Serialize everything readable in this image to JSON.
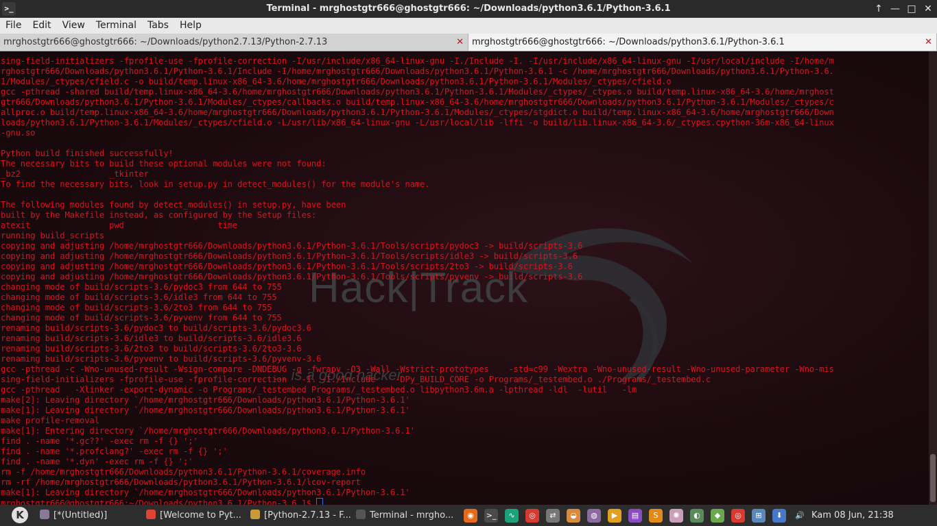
{
  "window": {
    "title": "Terminal - mrghostgtr666@ghostgtr666: ~/Downloads/python3.6.1/Python-3.6.1",
    "app_icon": ">_"
  },
  "menu": [
    "File",
    "Edit",
    "View",
    "Terminal",
    "Tabs",
    "Help"
  ],
  "tabs": [
    {
      "label": "mrghostgtr666@ghostgtr666: ~/Downloads/python2.7.13/Python-2.7.13",
      "close": "✕"
    },
    {
      "label": "mrghostgtr666@ghostgtr666: ~/Downloads/python3.6.1/Python-3.6.1",
      "close": "✕"
    }
  ],
  "terminal": {
    "lines": [
      "sing-field-initializers -fprofile-use -fprofile-correction -I/usr/include/x86_64-linux-gnu -I./Include -I. -I/usr/include/x86_64-linux-gnu -I/usr/local/include -I/home/m",
      "rghostgtr666/Downloads/python3.6.1/Python-3.6.1/Include -I/home/mrghostgtr666/Downloads/python3.6.1/Python-3.6.1 -c /home/mrghostgtr666/Downloads/python3.6.1/Python-3.6.",
      "1/Modules/_ctypes/cfield.c -o build/temp.linux-x86_64-3.6/home/mrghostgtr666/Downloads/python3.6.1/Python-3.6.1/Modules/_ctypes/cfield.o",
      "gcc -pthread -shared build/temp.linux-x86_64-3.6/home/mrghostgtr666/Downloads/python3.6.1/Python-3.6.1/Modules/_ctypes/_ctypes.o build/temp.linux-x86_64-3.6/home/mrghost",
      "gtr666/Downloads/python3.6.1/Python-3.6.1/Modules/_ctypes/callbacks.o build/temp.linux-x86_64-3.6/home/mrghostgtr666/Downloads/python3.6.1/Python-3.6.1/Modules/_ctypes/c",
      "allproc.o build/temp.linux-x86_64-3.6/home/mrghostgtr666/Downloads/python3.6.1/Python-3.6.1/Modules/_ctypes/stgdict.o build/temp.linux-x86_64-3.6/home/mrghostgtr666/Down",
      "loads/python3.6.1/Python-3.6.1/Modules/_ctypes/cfield.o -L/usr/lib/x86_64-linux-gnu -L/usr/local/lib -lffi -o build/lib.linux-x86_64-3.6/_ctypes.cpython-36m-x86_64-linux",
      "-gnu.so",
      "",
      "Python build finished successfully!",
      "The necessary bits to build these optional modules were not found:",
      "_bz2                  _tkinter",
      "To find the necessary bits, look in setup.py in detect_modules() for the module's name.",
      "",
      "The following modules found by detect_modules() in setup.py, have been",
      "built by the Makefile instead, as configured by the Setup files:",
      "atexit                pwd                   time",
      "running build_scripts",
      "copying and adjusting /home/mrghostgtr666/Downloads/python3.6.1/Python-3.6.1/Tools/scripts/pydoc3 -> build/scripts-3.6",
      "copying and adjusting /home/mrghostgtr666/Downloads/python3.6.1/Python-3.6.1/Tools/scripts/idle3 -> build/scripts-3.6",
      "copying and adjusting /home/mrghostgtr666/Downloads/python3.6.1/Python-3.6.1/Tools/scripts/2to3 -> build/scripts-3.6",
      "copying and adjusting /home/mrghostgtr666/Downloads/python3.6.1/Python-3.6.1/Tools/scripts/pyvenv -> build/scripts-3.6",
      "changing mode of build/scripts-3.6/pydoc3 from 644 to 755",
      "changing mode of build/scripts-3.6/idle3 from 644 to 755",
      "changing mode of build/scripts-3.6/2to3 from 644 to 755",
      "changing mode of build/scripts-3.6/pyvenv from 644 to 755",
      "renaming build/scripts-3.6/pydoc3 to build/scripts-3.6/pydoc3.6",
      "renaming build/scripts-3.6/idle3 to build/scripts-3.6/idle3.6",
      "renaming build/scripts-3.6/2to3 to build/scripts-3.6/2to3-3.6",
      "renaming build/scripts-3.6/pyvenv to build/scripts-3.6/pyvenv-3.6",
      "gcc -pthread -c -Wno-unused-result -Wsign-compare -DNDEBUG -g -fwrapv -O3 -Wall -Wstrict-prototypes    -std=c99 -Wextra -Wno-unused-result -Wno-unused-parameter -Wno-mis",
      "sing-field-initializers -fprofile-use -fprofile-correction   -I. -I./Include    -DPy_BUILD_CORE -o Programs/_testembed.o ./Programs/_testembed.c",
      "gcc -pthread   -Xlinker -export-dynamic -o Programs/_testembed Programs/_testembed.o libpython3.6m.a -lpthread -ldl  -lutil   -lm",
      "make[2]: Leaving directory `/home/mrghostgtr666/Downloads/python3.6.1/Python-3.6.1'",
      "make[1]: Leaving directory `/home/mrghostgtr666/Downloads/python3.6.1/Python-3.6.1'",
      "make profile-removal",
      "make[1]: Entering directory `/home/mrghostgtr666/Downloads/python3.6.1/Python-3.6.1'",
      "find . -name '*.gc??' -exec rm -f {} ';'",
      "find . -name '*.profclang?' -exec rm -f {} ';'",
      "find . -name '*.dyn' -exec rm -f {} ';'",
      "rm -f /home/mrghostgtr666/Downloads/python3.6.1/Python-3.6.1/coverage.info",
      "rm -rf /home/mrghostgtr666/Downloads/python3.6.1/Python-3.6.1/lcov-report",
      "make[1]: Leaving directory `/home/mrghostgtr666/Downloads/python3.6.1/Python-3.6.1'"
    ],
    "prompt": "mrghostgtr666@ghostgtr666:~/Downloads/python3.6.1/Python-3.6.1$ ",
    "text_color": "#d8141f",
    "watermark": "Hack|Track",
    "watermark_tagline": "... is a good hacker"
  },
  "taskbar": {
    "start_icon": "K",
    "tasks": [
      {
        "label": "[*(Untitled)]",
        "icon": "text-editor-icon",
        "color": "#8a7a9a"
      },
      {
        "label": "[Welcome to Pyt...",
        "icon": "chrome-icon",
        "color": "#dd4433"
      },
      {
        "label": "[Python-2.7.13 - F...",
        "icon": "folder-icon",
        "color": "#c89a3a"
      },
      {
        "label": "Terminal - mrgho...",
        "icon": "terminal-icon",
        "color": "#555555"
      }
    ],
    "tray": [
      {
        "icon": "firefox-icon",
        "glyph": "◉",
        "color": "#e66a1e"
      },
      {
        "icon": "terminal-icon",
        "glyph": ">_",
        "color": "#4a4a4a"
      },
      {
        "icon": "system-monitor-icon",
        "glyph": "∿",
        "color": "#1aa37a"
      },
      {
        "icon": "chrome-icon",
        "glyph": "◎",
        "color": "#d93a2f"
      },
      {
        "icon": "network-share-icon",
        "glyph": "⇄",
        "color": "#777777"
      },
      {
        "icon": "cake-icon",
        "glyph": "◒",
        "color": "#d88a40"
      },
      {
        "icon": "webcam-icon",
        "glyph": "◍",
        "color": "#8a6aa0"
      },
      {
        "icon": "media-player-icon",
        "glyph": "▶",
        "color": "#e0a020"
      },
      {
        "icon": "document-viewer-icon",
        "glyph": "▤",
        "color": "#8a4cbf"
      },
      {
        "icon": "sublime-icon",
        "glyph": "S",
        "color": "#e08a1a"
      },
      {
        "icon": "atom-icon",
        "glyph": "✺",
        "color": "#c9a0b8"
      },
      {
        "icon": "globe-icon",
        "glyph": "◐",
        "color": "#5a8a5a"
      },
      {
        "icon": "android-icon",
        "glyph": "◆",
        "color": "#6aa84f"
      },
      {
        "icon": "chrome-tray-icon",
        "glyph": "◎",
        "color": "#d93a2f"
      },
      {
        "icon": "network-icon",
        "glyph": "⊞",
        "color": "#5a88b8"
      },
      {
        "icon": "download-icon",
        "glyph": "⬇",
        "color": "#4a78c8"
      },
      {
        "icon": "volume-icon",
        "glyph": "🔊",
        "color": "#2d2d2d"
      }
    ],
    "clock": "Kam 08 Jun, 21:38"
  }
}
